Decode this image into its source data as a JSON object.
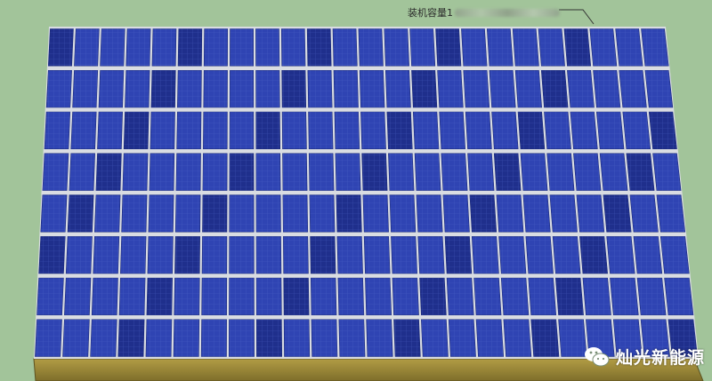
{
  "scene": {
    "annotation_label": "装机容量1",
    "watermark_text": "灿光新能源",
    "rows": 8,
    "columns": 24,
    "colors": {
      "background": "#a2c49a",
      "panel": "#2f44b3",
      "panel_dark": "#1f2f8c",
      "cell_line": "#5a6fd0",
      "frame": "#d6d9de",
      "base_wall": "#9c8a3a"
    }
  },
  "icons": {
    "watermark_logo": "wechat-icon",
    "leader_line": "leader-line"
  }
}
